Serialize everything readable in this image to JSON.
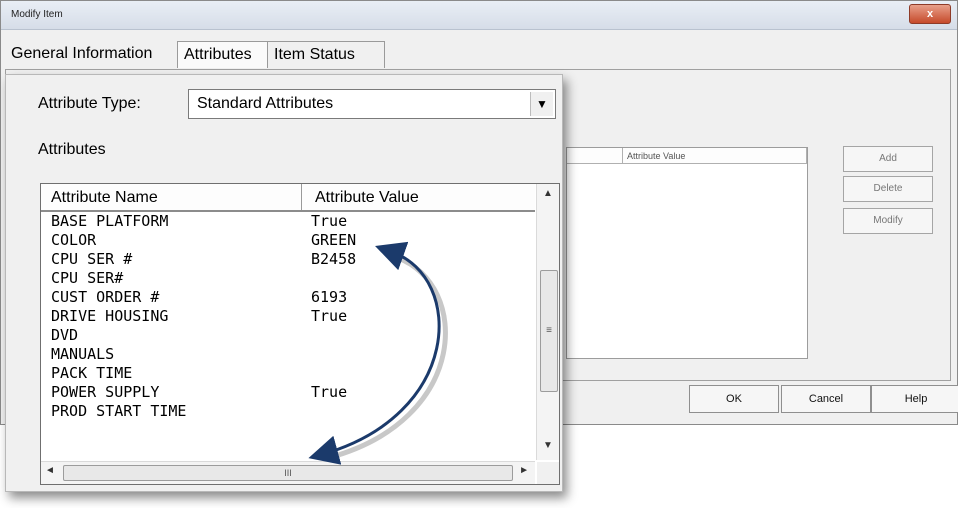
{
  "window": {
    "title": "Modify Item",
    "close_glyph": "x"
  },
  "tabs": [
    {
      "label": "General Information"
    },
    {
      "label": "Attributes"
    },
    {
      "label": "Item Status"
    }
  ],
  "background": {
    "column_header_2": "Attribute Value",
    "buttons": {
      "add": "Add",
      "delete": "Delete",
      "modify": "Modify"
    },
    "footer": {
      "ok": "OK",
      "cancel": "Cancel",
      "help": "Help"
    }
  },
  "attribute_type": {
    "label": "Attribute Type:",
    "selected": "Standard Attributes"
  },
  "attributes_label": "Attributes",
  "list": {
    "columns": [
      "Attribute Name",
      "Attribute Value"
    ],
    "rows": [
      {
        "name": "BASE PLATFORM",
        "value": "True"
      },
      {
        "name": "COLOR",
        "value": "GREEN"
      },
      {
        "name": "CPU SER #",
        "value": "B2458"
      },
      {
        "name": "CPU SER#",
        "value": ""
      },
      {
        "name": "CUST ORDER #",
        "value": "6193"
      },
      {
        "name": "DRIVE HOUSING",
        "value": "True"
      },
      {
        "name": "DVD",
        "value": ""
      },
      {
        "name": "MANUALS",
        "value": ""
      },
      {
        "name": "PACK TIME",
        "value": ""
      },
      {
        "name": "POWER SUPPLY",
        "value": "True"
      },
      {
        "name": "PROD START TIME",
        "value": ""
      }
    ]
  },
  "scroll": {
    "thumb_grip_v": "≡",
    "thumb_grip_h": "III",
    "up": "▲",
    "down": "▼",
    "left": "◄",
    "right": "►"
  },
  "annotation": {
    "arrow_color": "#1b3a6b"
  }
}
